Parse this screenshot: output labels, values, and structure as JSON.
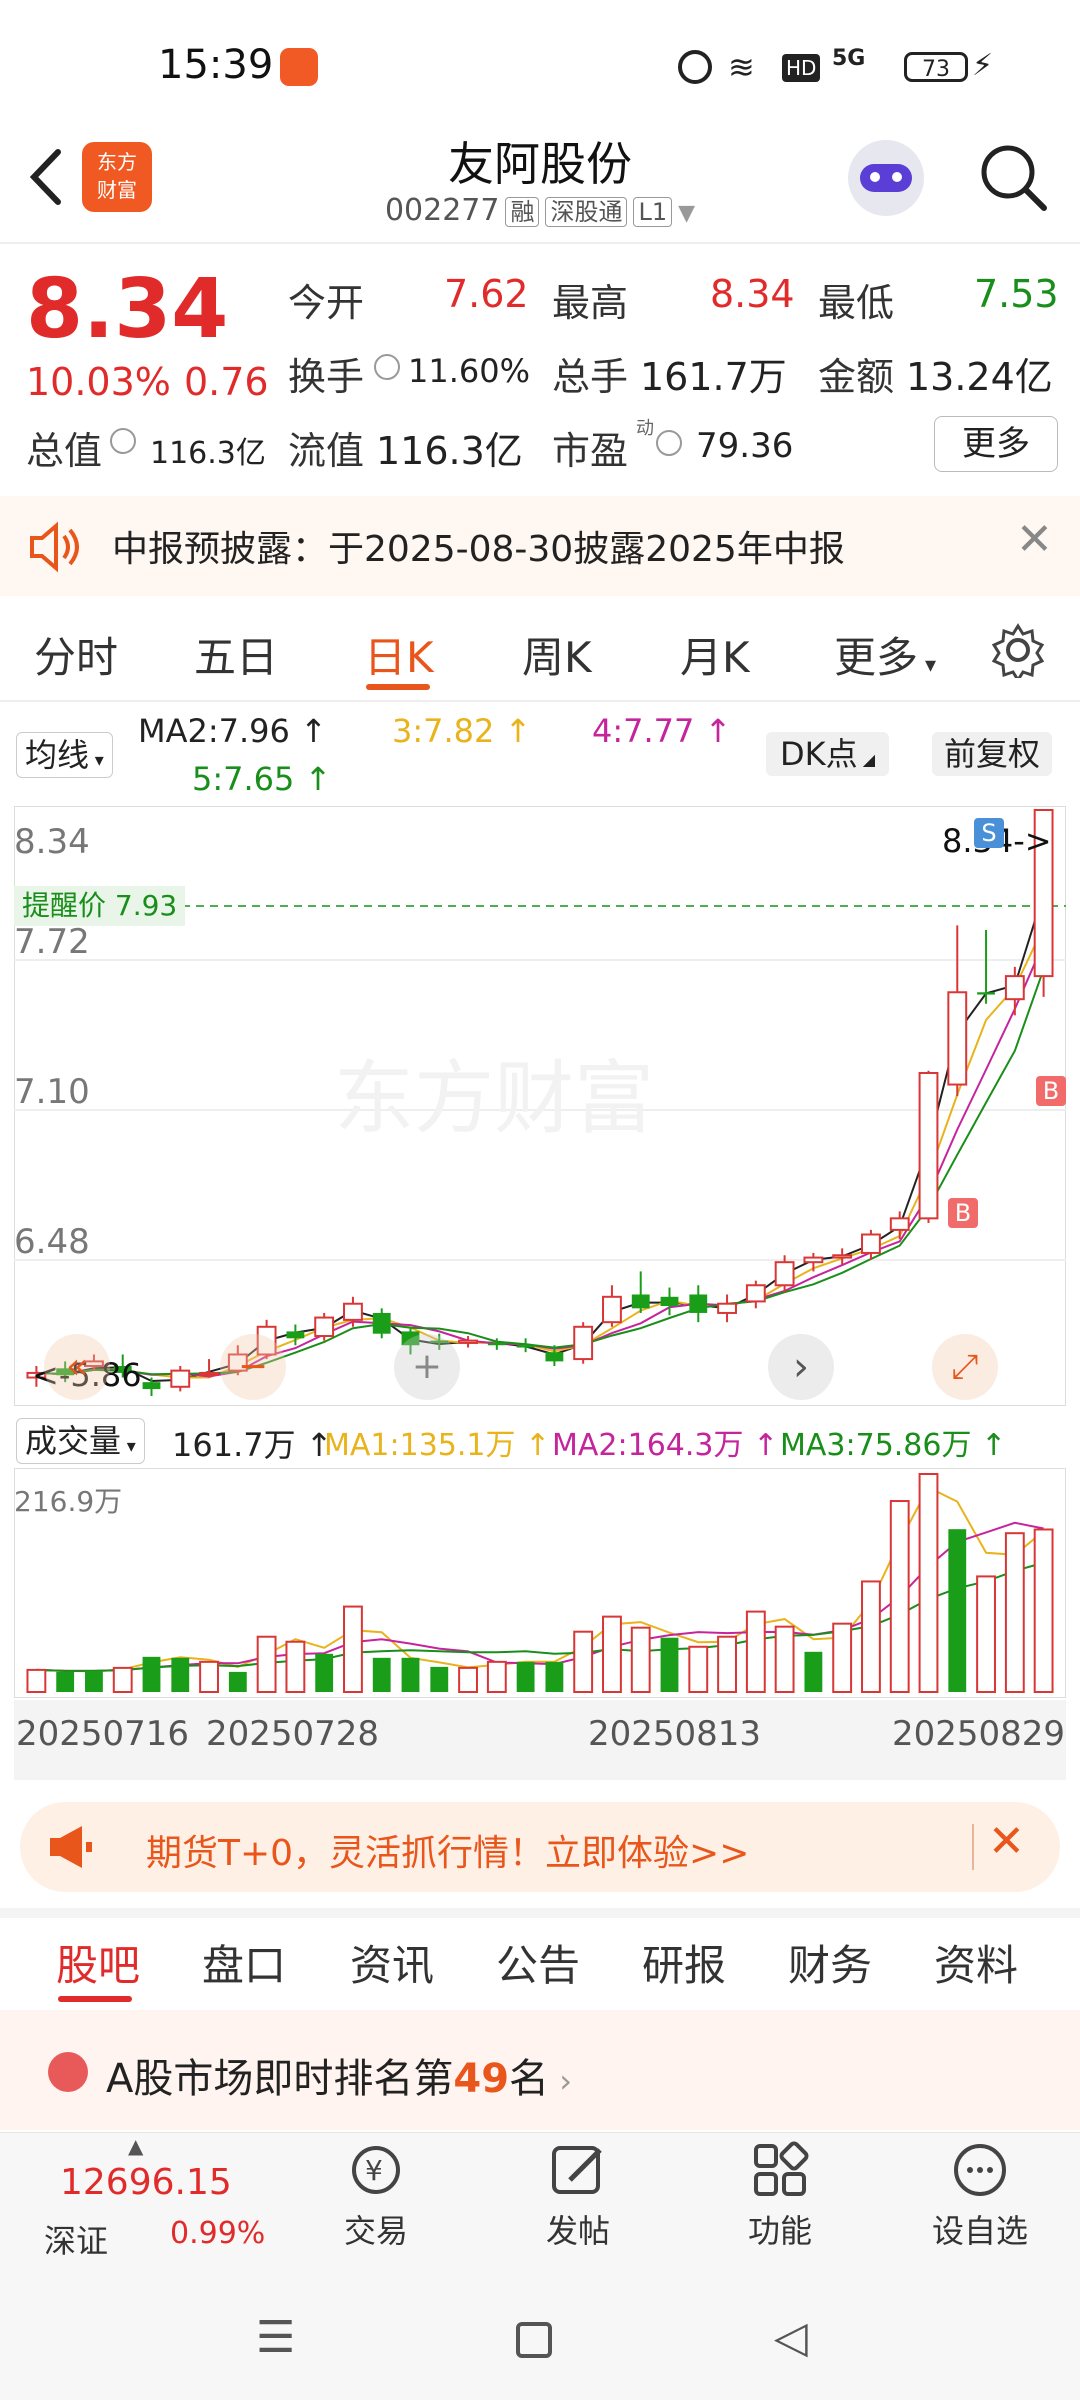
{
  "status": {
    "time": "15:39",
    "battery": "73",
    "network": "5G"
  },
  "header": {
    "title": "友阿股份",
    "code": "002277",
    "tag1": "融",
    "tag2": "深股通",
    "tag3": "L1",
    "logo_line1": "东方",
    "logo_line2": "财富"
  },
  "quote": {
    "price": "8.34",
    "pct": "10.03%",
    "change": "0.76",
    "open_label": "今开",
    "open": "7.62",
    "high_label": "最高",
    "high": "8.34",
    "low_label": "最低",
    "low": "7.53",
    "turnover_label": "换手",
    "turnover": "11.60%",
    "volume_label": "总手",
    "volume": "161.7万",
    "amount_label": "金额",
    "amount": "13.24亿",
    "mktcap_label": "总值",
    "mktcap": "116.3亿",
    "float_label": "流值",
    "float": "116.3亿",
    "pe_label": "市盈",
    "pe_sup": "动",
    "pe": "79.36",
    "more": "更多"
  },
  "notice": {
    "text": "中报预披露：于2025-08-30披露2025年中报"
  },
  "ktabs": [
    "分时",
    "五日",
    "日K",
    "周K",
    "月K",
    "更多"
  ],
  "ktab_active": "日K",
  "ma": {
    "selector": "均线",
    "ma2": "MA2:7.96",
    "ma3": "3:7.82",
    "ma4": "4:7.77",
    "ma5": "5:7.65",
    "dk": "DK点",
    "adjust": "前复权"
  },
  "chart": {
    "y_labels": [
      "8.34",
      "7.72",
      "7.10",
      "6.48"
    ],
    "alert": "提醒价 7.93",
    "high_marker": "8.34->",
    "low_marker": "<-5.86",
    "watermark": "东方财富",
    "sell_marker": "S",
    "buy_marker": "B"
  },
  "volume": {
    "selector": "成交量",
    "current": "161.7万",
    "ma1": "MA1:135.1万",
    "ma2": "MA2:164.3万",
    "ma3": "MA3:75.86万",
    "max_label": "216.9万"
  },
  "dates": [
    "20250716",
    "20250728",
    "20250813",
    "20250829"
  ],
  "chart_data": {
    "type": "candlestick",
    "price_axis": {
      "ticks": [
        8.34,
        7.72,
        7.1,
        6.48
      ],
      "ylim": [
        5.8,
        8.34
      ]
    },
    "candles": [
      {
        "o": 5.88,
        "c": 5.9,
        "h": 5.93,
        "l": 5.84,
        "up": true
      },
      {
        "o": 5.92,
        "c": 5.89,
        "h": 5.95,
        "l": 5.86,
        "up": false
      },
      {
        "o": 5.93,
        "c": 5.95,
        "h": 5.98,
        "l": 5.91,
        "up": true
      },
      {
        "o": 5.93,
        "c": 5.9,
        "h": 5.98,
        "l": 5.88,
        "up": false
      },
      {
        "o": 5.86,
        "c": 5.83,
        "h": 5.88,
        "l": 5.8,
        "up": false
      },
      {
        "o": 5.84,
        "c": 5.91,
        "h": 5.93,
        "l": 5.82,
        "up": true
      },
      {
        "o": 5.9,
        "c": 5.9,
        "h": 5.96,
        "l": 5.88,
        "up": true
      },
      {
        "o": 5.91,
        "c": 5.98,
        "h": 6.02,
        "l": 5.89,
        "up": true
      },
      {
        "o": 5.98,
        "c": 6.1,
        "h": 6.13,
        "l": 5.96,
        "up": true
      },
      {
        "o": 6.08,
        "c": 6.05,
        "h": 6.11,
        "l": 6.02,
        "up": false
      },
      {
        "o": 6.06,
        "c": 6.14,
        "h": 6.16,
        "l": 6.04,
        "up": true
      },
      {
        "o": 6.13,
        "c": 6.2,
        "h": 6.23,
        "l": 6.1,
        "up": true
      },
      {
        "o": 6.16,
        "c": 6.07,
        "h": 6.18,
        "l": 6.05,
        "up": false
      },
      {
        "o": 6.08,
        "c": 6.02,
        "h": 6.1,
        "l": 5.98,
        "up": false
      },
      {
        "o": 6.04,
        "c": 6.03,
        "h": 6.07,
        "l": 6.0,
        "up": false
      },
      {
        "o": 6.03,
        "c": 6.04,
        "h": 6.06,
        "l": 6.01,
        "up": true
      },
      {
        "o": 6.03,
        "c": 6.02,
        "h": 6.05,
        "l": 6.0,
        "up": false
      },
      {
        "o": 6.02,
        "c": 6.01,
        "h": 6.05,
        "l": 5.99,
        "up": false
      },
      {
        "o": 5.99,
        "c": 5.95,
        "h": 6.02,
        "l": 5.93,
        "up": false
      },
      {
        "o": 5.96,
        "c": 6.1,
        "h": 6.12,
        "l": 5.94,
        "up": true
      },
      {
        "o": 6.12,
        "c": 6.23,
        "h": 6.28,
        "l": 6.1,
        "up": true
      },
      {
        "o": 6.24,
        "c": 6.18,
        "h": 6.34,
        "l": 6.16,
        "up": false
      },
      {
        "o": 6.19,
        "c": 6.23,
        "h": 6.27,
        "l": 6.15,
        "up": false
      },
      {
        "o": 6.24,
        "c": 6.16,
        "h": 6.28,
        "l": 6.12,
        "up": false
      },
      {
        "o": 6.16,
        "c": 6.2,
        "h": 6.24,
        "l": 6.12,
        "up": true
      },
      {
        "o": 6.21,
        "c": 6.28,
        "h": 6.3,
        "l": 6.18,
        "up": true
      },
      {
        "o": 6.28,
        "c": 6.38,
        "h": 6.41,
        "l": 6.25,
        "up": true
      },
      {
        "o": 6.38,
        "c": 6.4,
        "h": 6.42,
        "l": 6.34,
        "up": true
      },
      {
        "o": 6.4,
        "c": 6.41,
        "h": 6.44,
        "l": 6.37,
        "up": true
      },
      {
        "o": 6.42,
        "c": 6.5,
        "h": 6.52,
        "l": 6.39,
        "up": true
      },
      {
        "o": 6.52,
        "c": 6.57,
        "h": 6.6,
        "l": 6.48,
        "up": true
      },
      {
        "o": 6.57,
        "c": 7.2,
        "h": 7.21,
        "l": 6.55,
        "up": true
      },
      {
        "o": 7.15,
        "c": 7.55,
        "h": 7.84,
        "l": 7.1,
        "up": true
      },
      {
        "o": 7.55,
        "c": 7.54,
        "h": 7.82,
        "l": 7.5,
        "up": false
      },
      {
        "o": 7.52,
        "c": 7.62,
        "h": 7.66,
        "l": 7.45,
        "up": true
      },
      {
        "o": 7.62,
        "c": 8.34,
        "h": 8.34,
        "l": 7.53,
        "up": true
      }
    ],
    "volume_axis_max": 216.9,
    "volumes": [
      {
        "v": 22,
        "up": true
      },
      {
        "v": 20,
        "up": false
      },
      {
        "v": 21,
        "up": false
      },
      {
        "v": 24,
        "up": true
      },
      {
        "v": 35,
        "up": false
      },
      {
        "v": 34,
        "up": false
      },
      {
        "v": 30,
        "up": true
      },
      {
        "v": 20,
        "up": false
      },
      {
        "v": 55,
        "up": true
      },
      {
        "v": 50,
        "up": true
      },
      {
        "v": 38,
        "up": false
      },
      {
        "v": 85,
        "up": true
      },
      {
        "v": 34,
        "up": false
      },
      {
        "v": 34,
        "up": false
      },
      {
        "v": 25,
        "up": false
      },
      {
        "v": 24,
        "up": true
      },
      {
        "v": 30,
        "up": true
      },
      {
        "v": 30,
        "up": false
      },
      {
        "v": 30,
        "up": false
      },
      {
        "v": 60,
        "up": true
      },
      {
        "v": 75,
        "up": true
      },
      {
        "v": 64,
        "up": true
      },
      {
        "v": 54,
        "up": false
      },
      {
        "v": 45,
        "up": true
      },
      {
        "v": 55,
        "up": true
      },
      {
        "v": 80,
        "up": true
      },
      {
        "v": 65,
        "up": true
      },
      {
        "v": 40,
        "up": false
      },
      {
        "v": 68,
        "up": true
      },
      {
        "v": 110,
        "up": true
      },
      {
        "v": 190,
        "up": true
      },
      {
        "v": 216.9,
        "up": true
      },
      {
        "v": 162,
        "up": false
      },
      {
        "v": 115,
        "up": true
      },
      {
        "v": 158,
        "up": true
      },
      {
        "v": 161.7,
        "up": true
      }
    ]
  },
  "banner": {
    "text": "期货T+0，灵活抓行情！立即体验>>"
  },
  "btabs": [
    "股吧",
    "盘口",
    "资讯",
    "公告",
    "研报",
    "财务",
    "资料"
  ],
  "btab_active": "股吧",
  "rank": {
    "prefix": "A股市场即时排名第",
    "num": "49",
    "suffix": "名"
  },
  "index": {
    "value": "12696.15",
    "name": "深证",
    "pct": "0.99%"
  },
  "nav": {
    "trade": "交易",
    "post": "发帖",
    "func": "功能",
    "watch": "设自选"
  }
}
